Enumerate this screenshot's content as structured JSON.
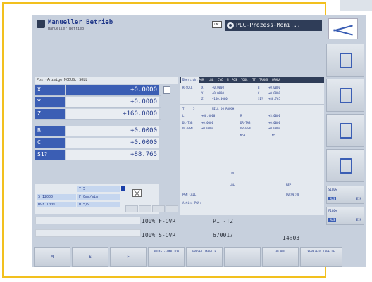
{
  "window": {
    "title": "Manueller Betrieb",
    "subtitle": "Manueller Betrieb",
    "dnc": "DNC",
    "plc_title": "PLC-Prozess-Moni..."
  },
  "position_display": {
    "header": "Pos.-Anzeige MODUS: SOLL",
    "axes": [
      {
        "label": "X",
        "value": "+0.0000"
      },
      {
        "label": "Y",
        "value": "+0.0000"
      },
      {
        "label": "Z",
        "value": "+160.0000"
      },
      {
        "label": "B",
        "value": "+0.0000"
      },
      {
        "label": "C",
        "value": "+0.0000"
      },
      {
        "label": "S1?",
        "value": "+88.765"
      }
    ]
  },
  "status": {
    "tool_no": "T 5",
    "s_value": "S 12000",
    "f_label": "F 0mm/min",
    "ovr": "Ovr 100%",
    "m": "M 5/9"
  },
  "right_tabs": [
    "Übersicht",
    "PGM",
    "LBL",
    "CYC",
    "M",
    "POS",
    "TOOL",
    "TT",
    "TRANS",
    "QPARA"
  ],
  "right_panel": {
    "rows": [
      [
        "RFSOLL",
        "X",
        "+0.0000",
        "B",
        "+0.0000"
      ],
      [
        "",
        "Y",
        "+0.0000",
        "C",
        "+0.0000"
      ],
      [
        "",
        "Z",
        "+160.0000",
        "S1?",
        "+88.765"
      ],
      [
        "T",
        "5",
        "MILL_D6_ROUGH",
        "",
        ""
      ],
      [
        "L",
        "+60.0000",
        "R",
        "+3.0000",
        ""
      ],
      [
        "DL-TAB",
        "+0.0000",
        "DR-TAB",
        "+0.0000",
        ""
      ],
      [
        "DL-PGM",
        "+0.0000",
        "DR-PGM",
        "+0.0000",
        ""
      ],
      [
        "",
        "M50",
        "M5",
        "",
        ""
      ]
    ],
    "lbl": "LBL",
    "rep": "REP",
    "pgm_call": "PGM CALL",
    "time": "00:00:00",
    "active_pgm": "Active PGM:"
  },
  "overrides": {
    "f_ovr": "100% F-OVR",
    "s_ovr": "100% S-OVR",
    "p1": "P1  -T2",
    "counter": "670017",
    "clock": "14:03"
  },
  "softkeys": [
    "M",
    "S",
    "F",
    "ANTAST-FUNKTION",
    "PRESET TABELLE",
    "",
    "3D ROT",
    "WERKZEUG TABELLE"
  ],
  "vertical_keys": [
    "",
    "",
    "",
    "",
    ""
  ],
  "ovr_keys": [
    {
      "pct": "S100%",
      "aus": "AUS",
      "ein": "EIN"
    },
    {
      "pct": "F100%",
      "aus": "AUS",
      "ein": "EIN"
    }
  ],
  "colors": {
    "accent": "#3b5eb4",
    "frame": "#f2c01e"
  }
}
